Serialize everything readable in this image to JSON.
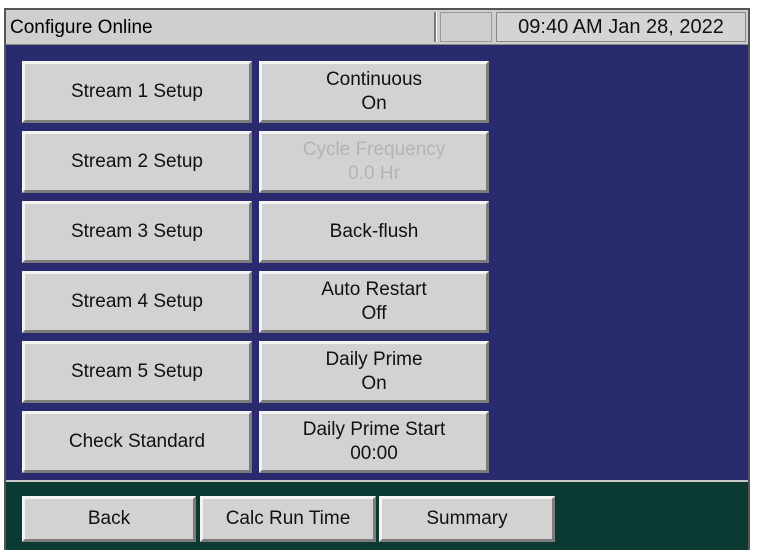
{
  "header": {
    "title": "Configure Online",
    "clock": "09:40 AM Jan 28, 2022"
  },
  "left_buttons": [
    {
      "label": "Stream 1 Setup"
    },
    {
      "label": "Stream 2 Setup"
    },
    {
      "label": "Stream 3 Setup"
    },
    {
      "label": "Stream 4 Setup"
    },
    {
      "label": "Stream 5 Setup"
    },
    {
      "label": "Check Standard"
    }
  ],
  "right_buttons": [
    {
      "line1": "Continuous",
      "line2": "On",
      "enabled": true
    },
    {
      "line1": "Cycle Frequency",
      "line2": "0.0  Hr",
      "enabled": false
    },
    {
      "line1": "Back-flush",
      "line2": "",
      "enabled": true
    },
    {
      "line1": "Auto Restart",
      "line2": "Off",
      "enabled": true
    },
    {
      "line1": "Daily Prime",
      "line2": "On",
      "enabled": true
    },
    {
      "line1": "Daily Prime Start",
      "line2": "00:00",
      "enabled": true
    }
  ],
  "footer": {
    "back": "Back",
    "calc_run_time": "Calc Run Time",
    "summary": "Summary"
  },
  "colors": {
    "panel": "#2a2a6e",
    "footer": "#0b3a32",
    "button": "#d2d2d2"
  }
}
